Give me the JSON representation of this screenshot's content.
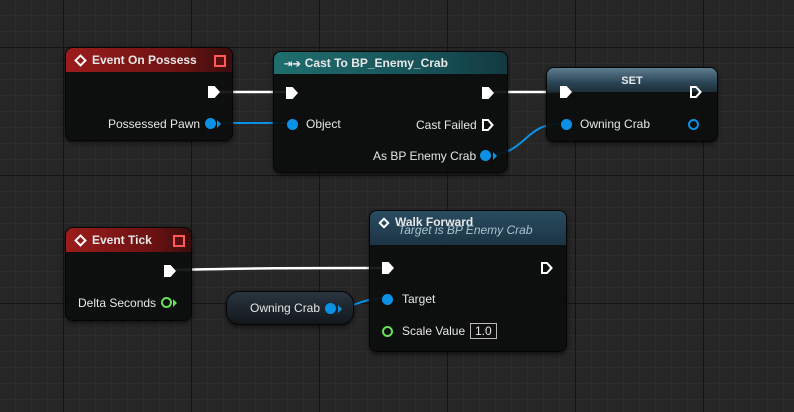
{
  "graph": {
    "event_on_possess": {
      "title": "Event On Possess",
      "out_label": "Possessed Pawn"
    },
    "cast": {
      "title": "Cast To BP_Enemy_Crab",
      "object_label": "Object",
      "failed_label": "Cast Failed",
      "as_label": "As BP Enemy Crab"
    },
    "set": {
      "title": "SET",
      "var_label": "Owning Crab"
    },
    "event_tick": {
      "title": "Event Tick",
      "out_label": "Delta Seconds"
    },
    "getter": {
      "label": "Owning Crab"
    },
    "walk": {
      "title": "Walk Forward",
      "subtitle": "Target is BP Enemy Crab",
      "target_label": "Target",
      "scale_label": "Scale Value",
      "scale_value": "1.0"
    }
  },
  "colors": {
    "exec_wire": "#ffffff",
    "object_wire": "#0b92e6",
    "float_pin": "#6ae05a"
  }
}
